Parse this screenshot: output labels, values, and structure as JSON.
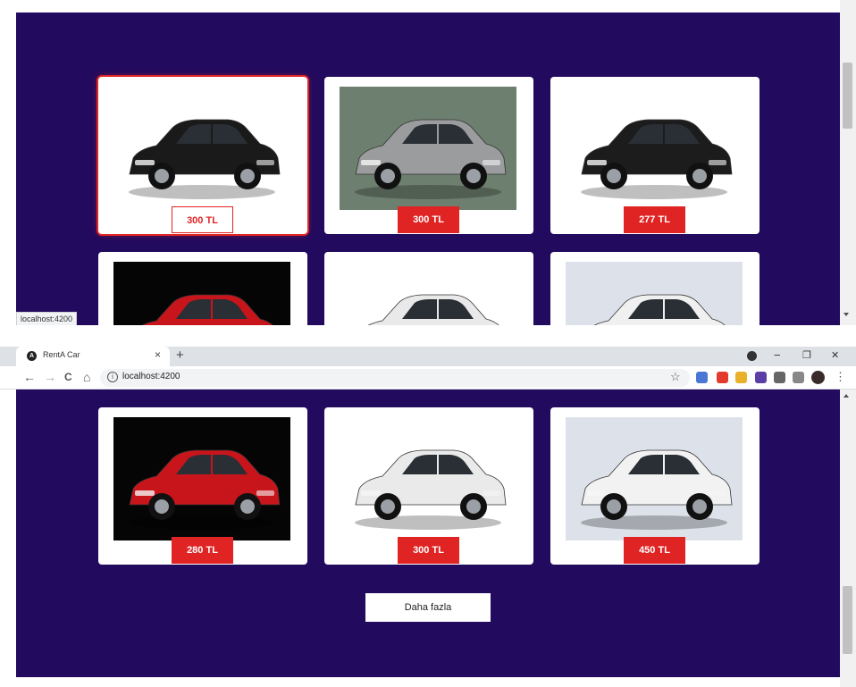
{
  "browser": {
    "tab_title": "RentA Car",
    "tab_close": "×",
    "new_tab": "+",
    "url": "localhost:4200",
    "status_url": "localhost:4200",
    "nav": {
      "back": "←",
      "forward": "→",
      "reload": "C",
      "home": "⌂"
    },
    "window": {
      "minimize": "−",
      "restore": "❐",
      "close": "✕"
    },
    "bookmark_star": "☆",
    "menu": "⋮",
    "info": "i"
  },
  "top_cards": [
    {
      "price": "300 TL",
      "car": "black sedan",
      "bg": "#ffffff",
      "color": "#1a1a1a",
      "hovered": true
    },
    {
      "price": "300 TL",
      "car": "silver sedan",
      "bg": "#6d7f6e",
      "color": "#9a9c9e",
      "hovered": false
    },
    {
      "price": "277 TL",
      "car": "black compact sedan",
      "bg": "#ffffff",
      "color": "#1c1c1c",
      "hovered": false
    }
  ],
  "top_cards_partial": [
    {
      "car": "red coupe",
      "bg": "#050505",
      "color": "#c8151b"
    },
    {
      "car": "white hatchback",
      "bg": "#ffffff",
      "color": "#e9e9e9"
    },
    {
      "car": "white sedan",
      "bg": "#dde2ea",
      "color": "#f0f0f0"
    }
  ],
  "bottom_cards": [
    {
      "price": "280 TL",
      "car": "red coupe",
      "bg": "#050505",
      "color": "#c8151b"
    },
    {
      "price": "300 TL",
      "car": "white hatchback",
      "bg": "#ffffff",
      "color": "#eaeaea"
    },
    {
      "price": "450 TL",
      "car": "white sedan",
      "bg": "#dde2ea",
      "color": "#f2f2f2"
    }
  ],
  "more_button": "Daha fazla",
  "colors": {
    "page_bg": "#220a5e",
    "price_tag": "#e02424",
    "card_bg": "#ffffff"
  }
}
